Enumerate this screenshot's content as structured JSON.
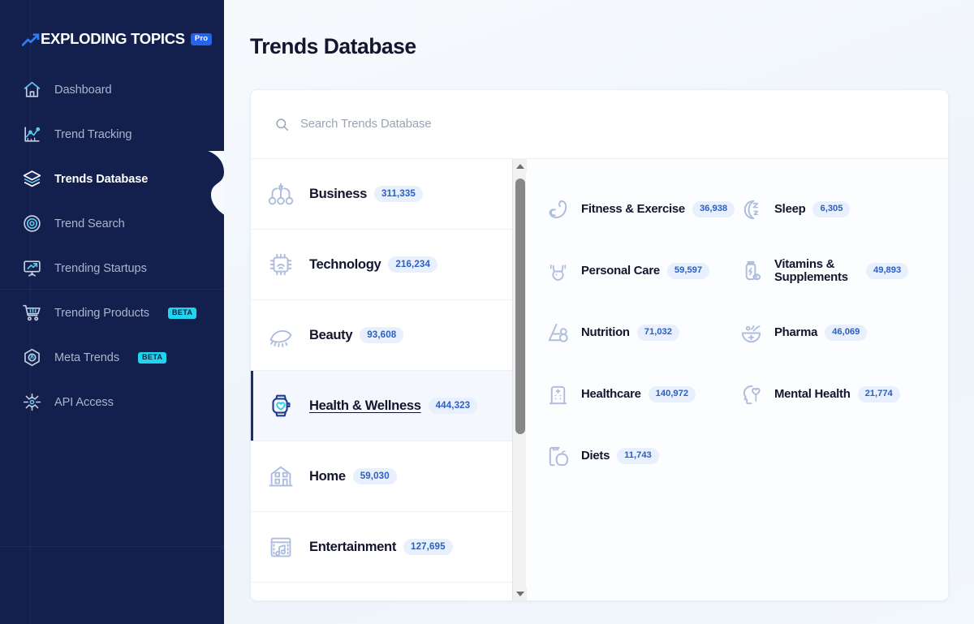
{
  "sidebar": {
    "brand": {
      "name": "EXPLODING TOPICS",
      "badge": "Pro"
    },
    "items": [
      {
        "label": "Dashboard",
        "icon": "home-icon",
        "badge": "",
        "active": false
      },
      {
        "label": "Trend Tracking",
        "icon": "chart-line-icon",
        "badge": "",
        "active": false
      },
      {
        "label": "Trends Database",
        "icon": "layers-icon",
        "badge": "",
        "active": true
      },
      {
        "label": "Trend Search",
        "icon": "target-icon",
        "badge": "",
        "active": false
      },
      {
        "label": "Trending Startups",
        "icon": "presentation-chart-icon",
        "badge": "",
        "active": false
      },
      {
        "label": "Trending Products",
        "icon": "shopping-cart-icon",
        "badge": "BETA",
        "active": false
      },
      {
        "label": "Meta Trends",
        "icon": "hexagon-icon",
        "badge": "BETA",
        "active": false
      },
      {
        "label": "API Access",
        "icon": "api-node-icon",
        "badge": "",
        "active": false
      }
    ]
  },
  "header": {
    "title": "Trends Database"
  },
  "search": {
    "value": "",
    "placeholder": "Search Trends Database",
    "icon": "search-icon"
  },
  "categories": [
    {
      "label": "Business",
      "count": "311,335",
      "icon": "business-dollar-icon",
      "selected": false
    },
    {
      "label": "Technology",
      "count": "216,234",
      "icon": "cpu-chip-icon",
      "selected": false
    },
    {
      "label": "Beauty",
      "count": "93,608",
      "icon": "eye-lashes-icon",
      "selected": false
    },
    {
      "label": "Health & Wellness",
      "count": "444,323",
      "icon": "smartwatch-heart-icon",
      "selected": true
    },
    {
      "label": "Home",
      "count": "59,030",
      "icon": "house-icon",
      "selected": false
    },
    {
      "label": "Entertainment",
      "count": "127,695",
      "icon": "film-music-icon",
      "selected": false
    }
  ],
  "subcategories": [
    {
      "label": "Fitness & Exercise",
      "count": "36,938",
      "icon": "bicep-icon"
    },
    {
      "label": "Sleep",
      "count": "6,305",
      "icon": "moon-zzz-icon"
    },
    {
      "label": "Personal Care",
      "count": "59,597",
      "icon": "body-care-icon"
    },
    {
      "label": "Vitamins & Supplements",
      "count": "49,893",
      "icon": "supplement-bottle-icon"
    },
    {
      "label": "Nutrition",
      "count": "71,032",
      "icon": "nutrition-icon"
    },
    {
      "label": "Pharma",
      "count": "46,069",
      "icon": "mortar-pestle-icon"
    },
    {
      "label": "Healthcare",
      "count": "140,972",
      "icon": "hospital-icon"
    },
    {
      "label": "Mental Health",
      "count": "21,774",
      "icon": "head-heart-icon"
    },
    {
      "label": "Diets",
      "count": "11,743",
      "icon": "clipboard-apple-icon"
    }
  ],
  "scrollbar": {
    "up_icon": "scroll-up-arrow-icon",
    "down_icon": "scroll-down-arrow-icon"
  },
  "colors": {
    "sidebar_bg": "#131f4d",
    "accent_blue": "#2563eb",
    "beta_cyan": "#22d3ee",
    "pill_bg": "#e8f0fd",
    "pill_text": "#2b5fc4",
    "selected_bar": "#1b2f6b",
    "icon_muted": "#aebcdd"
  }
}
